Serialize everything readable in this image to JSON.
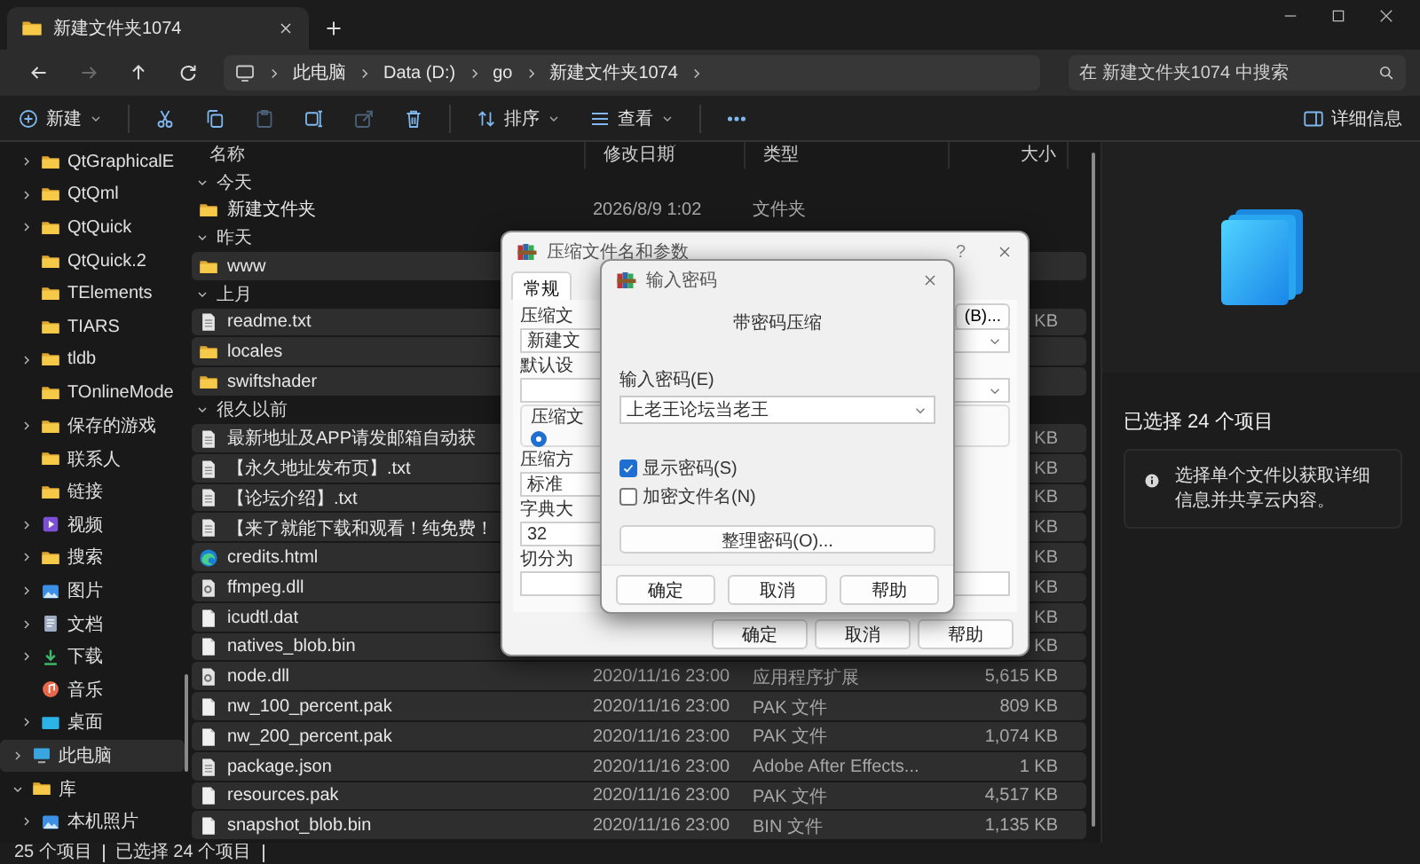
{
  "window": {
    "tab_title": "新建文件夹1074"
  },
  "nav": {
    "buttons": [
      {
        "kind": "back",
        "disabled": false
      },
      {
        "kind": "forward",
        "disabled": true
      },
      {
        "kind": "up",
        "disabled": false
      },
      {
        "kind": "refresh",
        "disabled": false
      }
    ],
    "breadcrumb": [
      "此电脑",
      "Data (D:)",
      "go",
      "新建文件夹1074"
    ],
    "search": {
      "placeholder": "在 新建文件夹1074 中搜索"
    }
  },
  "toolbar": {
    "items": [
      {
        "kind": "new",
        "label": "新建",
        "disabled": false
      },
      {
        "kind": "cut",
        "disabled": false
      },
      {
        "kind": "copy",
        "disabled": false
      },
      {
        "kind": "paste",
        "disabled": true
      },
      {
        "kind": "rename",
        "disabled": false
      },
      {
        "kind": "share",
        "disabled": true
      },
      {
        "kind": "delete",
        "disabled": false
      },
      {
        "kind": "sort",
        "label": "排序",
        "disabled": false
      },
      {
        "kind": "view",
        "label": "查看",
        "disabled": false
      },
      {
        "kind": "more",
        "disabled": false
      }
    ],
    "details": "详细信息"
  },
  "sidebar": {
    "continued": [
      {
        "label": "QtGraphicalE",
        "kind": "folder",
        "expandable": true,
        "expanded": false,
        "selected": false
      },
      {
        "label": "QtQml",
        "kind": "folder",
        "expandable": true,
        "expanded": false,
        "selected": false
      },
      {
        "label": "QtQuick",
        "kind": "folder",
        "expandable": true,
        "expanded": false,
        "selected": false
      },
      {
        "label": "QtQuick.2",
        "kind": "folder",
        "expandable": false,
        "expanded": false,
        "selected": false
      },
      {
        "label": "TElements",
        "kind": "folder",
        "expandable": false,
        "expanded": false,
        "selected": false
      },
      {
        "label": "TIARS",
        "kind": "folder",
        "expandable": false,
        "expanded": false,
        "selected": false
      },
      {
        "label": "tldb",
        "kind": "folder",
        "expandable": true,
        "expanded": false,
        "selected": false
      },
      {
        "label": "TOnlineMode",
        "kind": "folder",
        "expandable": false,
        "expanded": false,
        "selected": false
      },
      {
        "label": "保存的游戏",
        "kind": "folder",
        "expandable": true,
        "expanded": false,
        "selected": false
      },
      {
        "label": "联系人",
        "kind": "folder",
        "expandable": false,
        "expanded": false,
        "selected": false
      },
      {
        "label": "链接",
        "kind": "folder",
        "expandable": false,
        "expanded": false,
        "selected": false
      },
      {
        "label": "视频",
        "kind": "video",
        "expandable": true,
        "expanded": false,
        "selected": false
      },
      {
        "label": "搜索",
        "kind": "folder",
        "expandable": true,
        "expanded": false,
        "selected": false
      },
      {
        "label": "图片",
        "kind": "pictures",
        "expandable": true,
        "expanded": false,
        "selected": false
      },
      {
        "label": "文档",
        "kind": "docs",
        "expandable": true,
        "expanded": false,
        "selected": false
      },
      {
        "label": "下载",
        "kind": "download",
        "expandable": true,
        "expanded": false,
        "selected": false
      },
      {
        "label": "音乐",
        "kind": "music",
        "expandable": false,
        "expanded": false,
        "selected": false
      },
      {
        "label": "桌面",
        "kind": "desktop",
        "expandable": true,
        "expanded": false,
        "selected": false
      }
    ],
    "items": [
      {
        "label": "此电脑",
        "kind": "pc",
        "expandable": true,
        "expanded": false,
        "selected": true
      },
      {
        "label": "库",
        "kind": "folder",
        "expandable": true,
        "expanded": true,
        "selected": false,
        "children": [
          {
            "label": "本机照片",
            "kind": "pictures",
            "expandable": true,
            "expanded": false,
            "selected": false
          }
        ]
      }
    ]
  },
  "columns": [
    {
      "label": "名称",
      "sorted": false
    },
    {
      "label": "修改日期",
      "sorted": true
    },
    {
      "label": "类型",
      "sorted": false
    },
    {
      "label": "大小",
      "sorted": false
    }
  ],
  "groups": [
    {
      "label": "今天",
      "expanded": true,
      "rows": [
        {
          "name": "新建文件夹",
          "kind": "folder",
          "selected": false,
          "date": "2026/8/9 1:02",
          "type": "文件夹"
        }
      ]
    },
    {
      "label": "昨天",
      "expanded": true,
      "rows": [
        {
          "name": "www",
          "kind": "folder",
          "selected": true
        }
      ]
    },
    {
      "label": "上月",
      "expanded": true,
      "rows": [
        {
          "name": "readme.txt",
          "kind": "text",
          "selected": true,
          "size": "KB"
        },
        {
          "name": "locales",
          "kind": "folder",
          "selected": true
        },
        {
          "name": "swiftshader",
          "kind": "folder",
          "selected": true
        }
      ]
    },
    {
      "label": "很久以前",
      "expanded": true,
      "rows": [
        {
          "name": "最新地址及APP请发邮箱自动获",
          "kind": "text",
          "selected": true,
          "size": "KB"
        },
        {
          "name": "【永久地址发布页】.txt",
          "kind": "text",
          "selected": true,
          "size": "KB"
        },
        {
          "name": "【论坛介绍】.txt",
          "kind": "text",
          "selected": true,
          "size": "KB"
        },
        {
          "name": "【来了就能下载和观看！纯免费！",
          "kind": "text",
          "selected": true,
          "size": "KB"
        },
        {
          "name": "credits.html",
          "kind": "web",
          "selected": true,
          "size": "KB"
        },
        {
          "name": "ffmpeg.dll",
          "kind": "dll",
          "selected": true,
          "size": "KB"
        },
        {
          "name": "icudtl.dat",
          "kind": "file",
          "selected": true,
          "size": "KB"
        },
        {
          "name": "natives_blob.bin",
          "kind": "file",
          "selected": true,
          "size": "KB"
        },
        {
          "name": "node.dll",
          "kind": "dll",
          "selected": true,
          "date": "2020/11/16 23:00",
          "type": "应用程序扩展",
          "size": "5,615 KB"
        },
        {
          "name": "nw_100_percent.pak",
          "kind": "file",
          "selected": true,
          "date": "2020/11/16 23:00",
          "type": "PAK 文件",
          "size": "809 KB"
        },
        {
          "name": "nw_200_percent.pak",
          "kind": "file",
          "selected": true,
          "date": "2020/11/16 23:00",
          "type": "PAK 文件",
          "size": "1,074 KB"
        },
        {
          "name": "package.json",
          "kind": "text",
          "selected": true,
          "date": "2020/11/16 23:00",
          "type": "Adobe After Effects...",
          "size": "1 KB"
        },
        {
          "name": "resources.pak",
          "kind": "file",
          "selected": true,
          "date": "2020/11/16 23:00",
          "type": "PAK 文件",
          "size": "4,517 KB"
        },
        {
          "name": "snapshot_blob.bin",
          "kind": "file",
          "selected": true,
          "date": "2020/11/16 23:00",
          "type": "BIN 文件",
          "size": "1,135 KB"
        }
      ]
    }
  ],
  "details_pane": {
    "heading": "已选择 24 个项目",
    "info": "选择单个文件以获取详细信息并共享云内容。"
  },
  "status_bar": {
    "items": [
      "25 个项目",
      "已选择 24 个项目"
    ]
  },
  "archive_dialog": {
    "title": "压缩文件名和参数",
    "help": "?",
    "tabs": [
      {
        "label": "常规",
        "selected": true
      }
    ],
    "rows": [
      {
        "kind": "label",
        "text": "压缩文",
        "button": "(B)..."
      },
      {
        "kind": "combo",
        "value": "新建文"
      },
      {
        "kind": "label",
        "text": "默认设"
      },
      {
        "kind": "combo"
      },
      {
        "kind": "group",
        "text": "压缩文",
        "selected": true
      },
      {
        "kind": "label",
        "text": "压缩方"
      },
      {
        "kind": "select",
        "value": "标准"
      },
      {
        "kind": "label",
        "text": "字典大"
      },
      {
        "kind": "select",
        "value": "32"
      },
      {
        "kind": "label",
        "text": "切分为"
      },
      {
        "kind": "input"
      }
    ],
    "buttons": [
      "确定",
      "取消",
      "帮助"
    ]
  },
  "password_dialog": {
    "title": "输入密码",
    "heading": "带密码压缩",
    "password_label": "输入密码(E)",
    "password": {
      "value": "上老王论坛当老王"
    },
    "options": [
      {
        "label": "显示密码(S)",
        "checked": true
      },
      {
        "label": "加密文件名(N)",
        "checked": false
      }
    ],
    "organize_button": "整理密码(O)...",
    "buttons": [
      "确定",
      "取消",
      "帮助"
    ]
  }
}
